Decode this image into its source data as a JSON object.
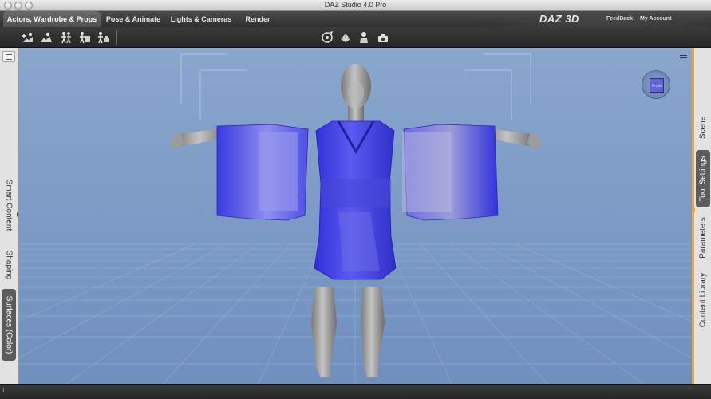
{
  "window": {
    "title": "DAZ Studio 4.0 Pro"
  },
  "tabs": [
    {
      "label": "Actors, Wardrobe & Props",
      "active": true
    },
    {
      "label": "Pose & Animate",
      "active": false
    },
    {
      "label": "Lights & Cameras",
      "active": false
    },
    {
      "label": "Render",
      "active": false
    }
  ],
  "header": {
    "brand": "DAZ 3D",
    "links": {
      "feedback": "FeedBack",
      "account": "My Account"
    }
  },
  "toolbar": {
    "left_tools": [
      "load-figure-icon",
      "load-environment-icon",
      "pose-figure-icon",
      "wardrobe-icon",
      "prop-icon"
    ],
    "center_tools": [
      "universal-tool-icon",
      "geometry-tool-icon",
      "node-select-icon",
      "render-camera-icon"
    ]
  },
  "left_panel": {
    "tabs": [
      {
        "label": "Smart Content",
        "active": false
      },
      {
        "label": "Shaping",
        "active": false
      },
      {
        "label": "Surfaces (Color)",
        "active": true
      }
    ]
  },
  "right_panel": {
    "tabs": [
      {
        "label": "Scene",
        "active": false
      },
      {
        "label": "Tool Settings",
        "active": true
      },
      {
        "label": "Parameters",
        "active": false
      },
      {
        "label": "Content Library",
        "active": false
      }
    ]
  },
  "viewport": {
    "cube_label": "Front",
    "background_color": "#7f9cc4",
    "figure_color": "#9a9a9a",
    "garment_color": "#3a3ae6"
  },
  "status": {
    "indicator": "!"
  },
  "colors": {
    "accent": "#f2a23a",
    "tab_active": "#5c5c5c"
  }
}
